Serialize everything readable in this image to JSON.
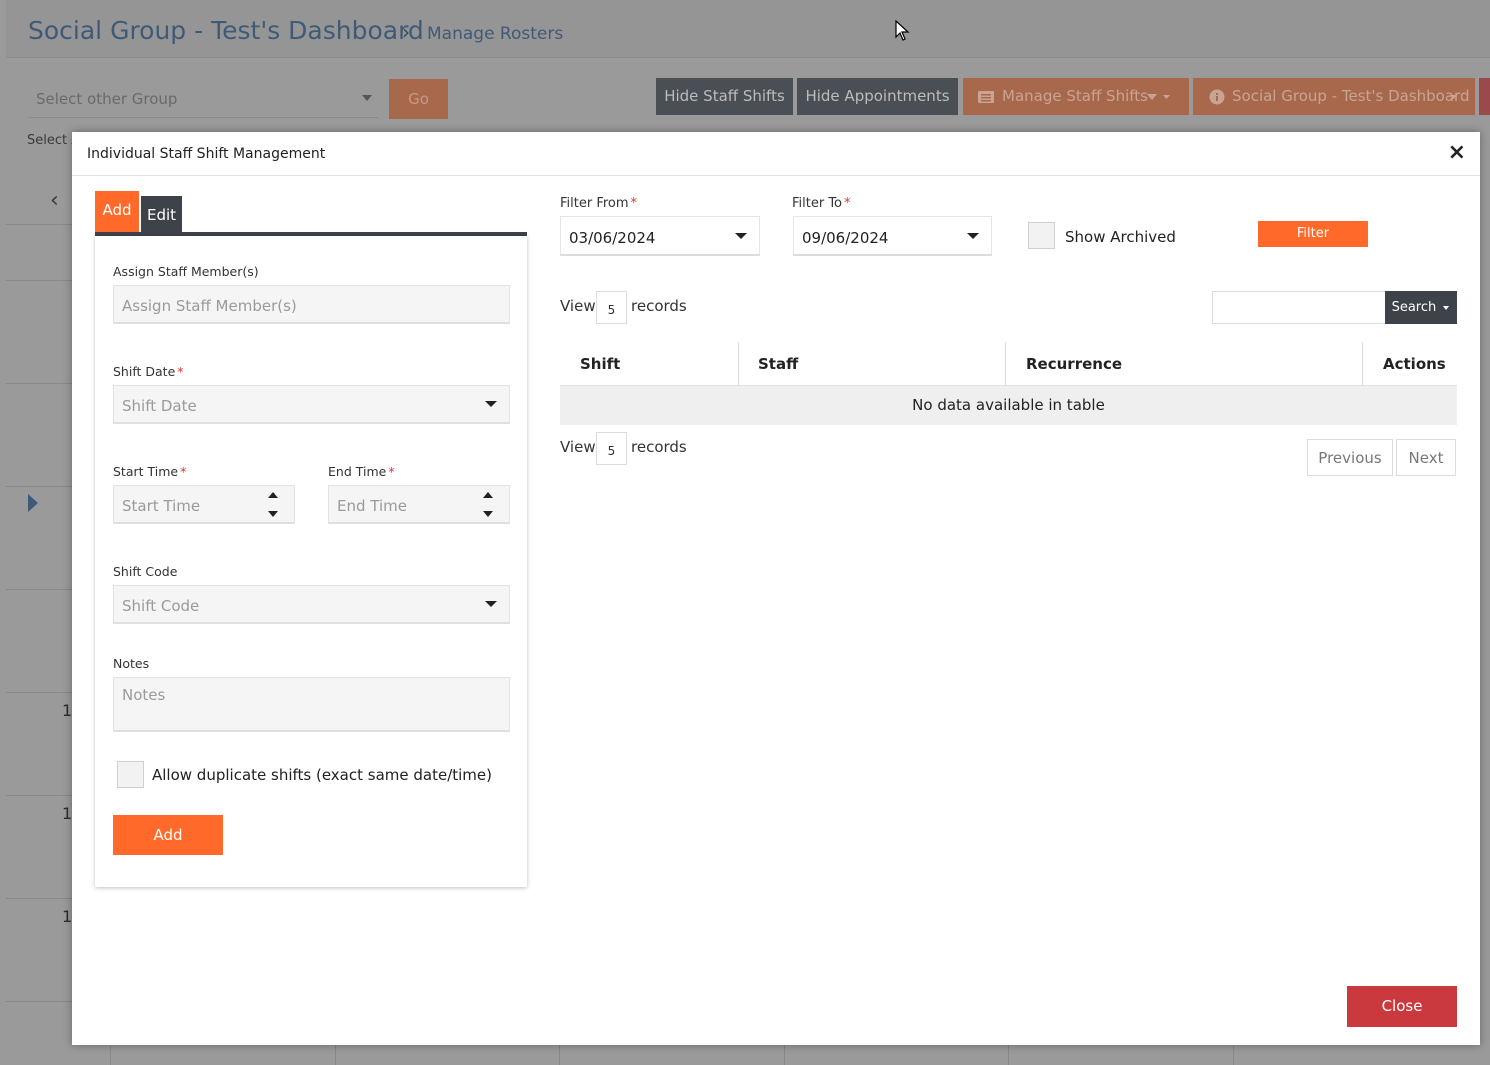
{
  "background": {
    "title": "Social Group - Test's Dashboard",
    "breadcrumb_sep": "›",
    "breadcrumb": "Manage Rosters",
    "group_select_placeholder": "Select other Group",
    "go_label": "Go",
    "hide_staff_shifts": "Hide Staff Shifts",
    "hide_appointments": "Hide Appointments",
    "manage_staff_shifts": "Manage Staff Shifts",
    "dashboard_menu": "Social Group - Test's Dashboard",
    "select_label": "Select A",
    "nav_prev": "‹",
    "row_numbers": [
      "1",
      "1",
      "1"
    ]
  },
  "modal": {
    "title": "Individual Staff Shift Management",
    "close_x": "×",
    "tabs": {
      "add": "Add",
      "edit": "Edit"
    },
    "form": {
      "assign_label": "Assign Staff Member(s)",
      "assign_placeholder": "Assign Staff Member(s)",
      "shift_date_label": "Shift Date",
      "shift_date_placeholder": "Shift Date",
      "start_time_label": "Start Time",
      "start_time_placeholder": "Start Time",
      "end_time_label": "End Time",
      "end_time_placeholder": "End Time",
      "shift_code_label": "Shift Code",
      "shift_code_placeholder": "Shift Code",
      "notes_label": "Notes",
      "notes_placeholder": "Notes",
      "allow_duplicate_label": "Allow duplicate shifts (exact same date/time)",
      "add_button": "Add",
      "required_mark": "*"
    },
    "filter": {
      "from_label": "Filter From",
      "from_value": "03/06/2024",
      "to_label": "Filter To",
      "to_value": "09/06/2024",
      "show_archived": "Show Archived",
      "filter_button": "Filter"
    },
    "table": {
      "view_label": "View",
      "page_size": "5",
      "records_label": "records",
      "search_button": "Search",
      "columns": [
        "Shift",
        "Staff",
        "Recurrence",
        "Actions"
      ],
      "empty_message": "No data available in table",
      "previous": "Previous",
      "next": "Next"
    },
    "close_button": "Close"
  },
  "colors": {
    "accent": "#ff6a2b",
    "dark": "#3e434a",
    "danger": "#c9393e"
  }
}
